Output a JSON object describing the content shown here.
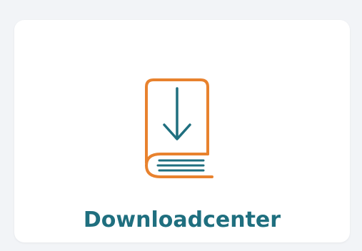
{
  "tile": {
    "label": "Downloadcenter",
    "icon": "book-download-icon"
  },
  "colors": {
    "background": "#f2f4f7",
    "card": "#ffffff",
    "label": "#1f6f7f",
    "icon_outline": "#e8822e",
    "icon_detail": "#1f6f7f"
  }
}
